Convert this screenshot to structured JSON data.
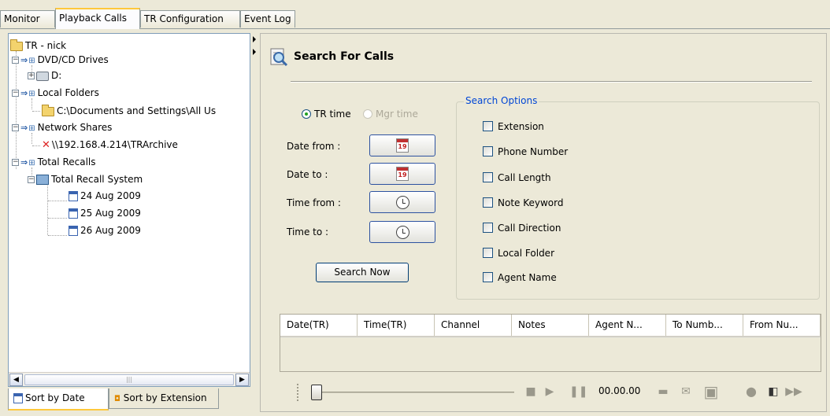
{
  "tabs": [
    "Monitor",
    "Playback Calls",
    "TR Configuration",
    "Event Log"
  ],
  "active_tab": "Playback Calls",
  "tree": {
    "root": "TR - nick",
    "dvd": "DVD/CD Drives",
    "drive_d": "D:",
    "local_folders": "Local Folders",
    "local_path": "C:\\Documents and Settings\\All Us",
    "network_shares": "Network Shares",
    "network_path": "\\\\192.168.4.214\\TRArchive",
    "total_recalls": "Total Recalls",
    "total_recall_system": "Total Recall System",
    "dates": [
      "24 Aug 2009",
      "25 Aug 2009",
      "26 Aug 2009"
    ]
  },
  "scroll_mark": "|||",
  "bottom_tabs": [
    "Sort by Date",
    "Sort by Extension"
  ],
  "search": {
    "title": "Search For Calls",
    "radio_tr": "TR time",
    "radio_mgr": "Mgr time",
    "date_from": "Date from :",
    "date_to": "Date to :",
    "time_from": "Time from :",
    "time_to": "Time to :",
    "calendar_day": "19",
    "search_now": "Search Now"
  },
  "options": {
    "title": "Search Options",
    "items": [
      "Extension",
      "Phone Number",
      "Call Length",
      "Note Keyword",
      "Call Direction",
      "Local Folder",
      "Agent Name"
    ]
  },
  "grid": {
    "columns": [
      "Date(TR)",
      "Time(TR)",
      "Channel",
      "Notes",
      "Agent N...",
      "To Numb...",
      "From Nu..."
    ]
  },
  "player": {
    "time": "00.00.00"
  }
}
